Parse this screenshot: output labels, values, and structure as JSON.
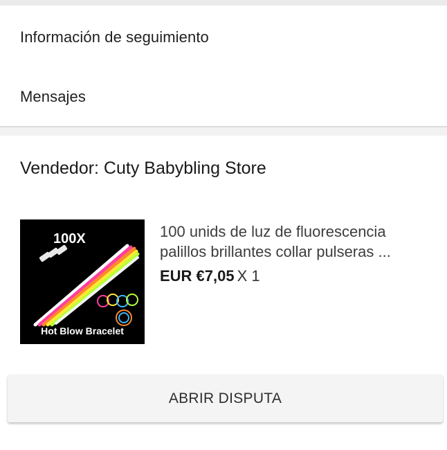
{
  "menu": {
    "tracking_label": "Información de seguimiento",
    "messages_label": "Mensajes"
  },
  "order": {
    "seller_label": "Vendedor: Cuty Babybling Store",
    "item": {
      "name_line1": "100 unids de luz de fluorescencia",
      "name_line2": "palillos brillantes collar pulseras ...",
      "price": "EUR €7,05",
      "quantity": "X 1",
      "image_text_top": "100X",
      "image_text_bottom": "Hot Blow Bracelet"
    },
    "dispute_button": "ABRIR DISPUTA"
  }
}
